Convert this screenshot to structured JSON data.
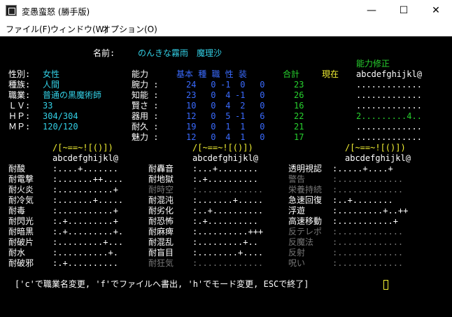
{
  "window": {
    "title": "変愚蛮怒 (勝手版)",
    "minimize_glyph": "—",
    "maximize_glyph": "☐",
    "close_glyph": "✕"
  },
  "menu": [
    "ファイル(F)",
    "ウィンドウ(W)",
    "オプション(O)"
  ],
  "profile": {
    "name_label": "名前:",
    "name_value": "のんきな霧雨　魔理沙",
    "ability_mod_title": "能力修正",
    "sex_label": "性別:",
    "sex_value": "女性",
    "race_label": "種族:",
    "race_value": "人間",
    "class_label": "職業:",
    "class_value": "普通の黒魔術師",
    "lv_label": "ＬＶ:",
    "lv_value": "33",
    "hp_label": "ＨＰ:",
    "hp_value": "304/304",
    "mp_label": "ＭＰ:",
    "mp_value": "120/120"
  },
  "stats": {
    "header_ability": "能力",
    "header_cols": "基本 種 職 性 装",
    "header_total": "合計",
    "header_current": "現在",
    "header_mod_letters": "abcdefghijkl@",
    "rows": [
      {
        "name": "腕力 :",
        "base": "24",
        "race": "0",
        "class": "-1",
        "pers": "0",
        "equip": "0",
        "total": "23",
        "mods": "............."
      },
      {
        "name": "知能 :",
        "base": "23",
        "race": "0",
        "class": "4",
        "pers": "-1",
        "equip": "0",
        "total": "26",
        "mods": "............."
      },
      {
        "name": "賢さ :",
        "base": "10",
        "race": "0",
        "class": "4",
        "pers": "2",
        "equip": "0",
        "total": "16",
        "mods": "............."
      },
      {
        "name": "器用 :",
        "base": "12",
        "race": "0",
        "class": "5",
        "pers": "-1",
        "equip": "6",
        "total": "22",
        "mods": "2.........4.."
      },
      {
        "name": "耐久 :",
        "base": "19",
        "race": "0",
        "class": "1",
        "pers": "1",
        "equip": "0",
        "total": "21",
        "mods": "............."
      },
      {
        "name": "魅力 :",
        "base": "12",
        "race": "0",
        "class": "4",
        "pers": "1",
        "equip": "0",
        "total": "17",
        "mods": "............."
      }
    ]
  },
  "resist": {
    "col_header": "abcdefghijkl@",
    "col_marker": "/[~==~![()])",
    "col1": [
      {
        "label": "耐酸",
        "vals": ":....+.......",
        "dim": false
      },
      {
        "label": "耐電撃",
        "vals": ":.......++....",
        "dim": false
      },
      {
        "label": "耐火炎",
        "vals": ":...........+",
        "dim": false
      },
      {
        "label": "耐冷気",
        "vals": ":.......+.....",
        "dim": false
      },
      {
        "label": "耐毒",
        "vals": ":...........+",
        "dim": false
      },
      {
        "label": "耐閃光",
        "vals": ":.+.........+",
        "dim": false
      },
      {
        "label": "耐暗黒",
        "vals": ":.+.........+.",
        "dim": false
      },
      {
        "label": "耐破片",
        "vals": ":.........+...",
        "dim": false
      },
      {
        "label": "耐水",
        "vals": ":..........+.",
        "dim": false
      },
      {
        "label": "耐破邪",
        "vals": ":.+..........",
        "dim": false
      }
    ],
    "col2": [
      {
        "label": "耐轟音",
        "vals": ":...+........",
        "dim": false
      },
      {
        "label": "耐地獄",
        "vals": ":.+..........",
        "dim": false
      },
      {
        "label": "耐時空",
        "vals": ":.............",
        "dim": true
      },
      {
        "label": "耐混沌",
        "vals": ":.......+.....",
        "dim": false
      },
      {
        "label": "耐劣化",
        "vals": ":..+..........",
        "dim": false
      },
      {
        "label": "耐恐怖",
        "vals": ":.+..........",
        "dim": false
      },
      {
        "label": "耐麻痺",
        "vals": ":..........+++",
        "dim": false
      },
      {
        "label": "耐混乱",
        "vals": ":.........+..",
        "dim": false
      },
      {
        "label": "耐盲目",
        "vals": ":........+....",
        "dim": false
      },
      {
        "label": "耐狂気",
        "vals": ":.............",
        "dim": true
      }
    ],
    "col3": [
      {
        "label": "透明視認",
        "vals": ":.....+....+",
        "dim": false
      },
      {
        "label": "警告",
        "vals": ":.............",
        "dim": true
      },
      {
        "label": "栄養持続",
        "vals": ":.............",
        "dim": true
      },
      {
        "label": "急速回復",
        "vals": ":..+........",
        "dim": false
      },
      {
        "label": "浮遊",
        "vals": ":.........+..++",
        "dim": false
      },
      {
        "label": "高速移動",
        "vals": ":...........+",
        "dim": false
      },
      {
        "label": "反テレポ",
        "vals": ":.............",
        "dim": true
      },
      {
        "label": "反魔法",
        "vals": ":.............",
        "dim": true
      },
      {
        "label": "反射",
        "vals": ":.............",
        "dim": true
      },
      {
        "label": "呪い",
        "vals": ":.............",
        "dim": true
      }
    ]
  },
  "footer": {
    "prompt": "['c'で職業名変更, 'f'でファイルへ書出, 'h'でモード変更, ESCで終了]"
  }
}
